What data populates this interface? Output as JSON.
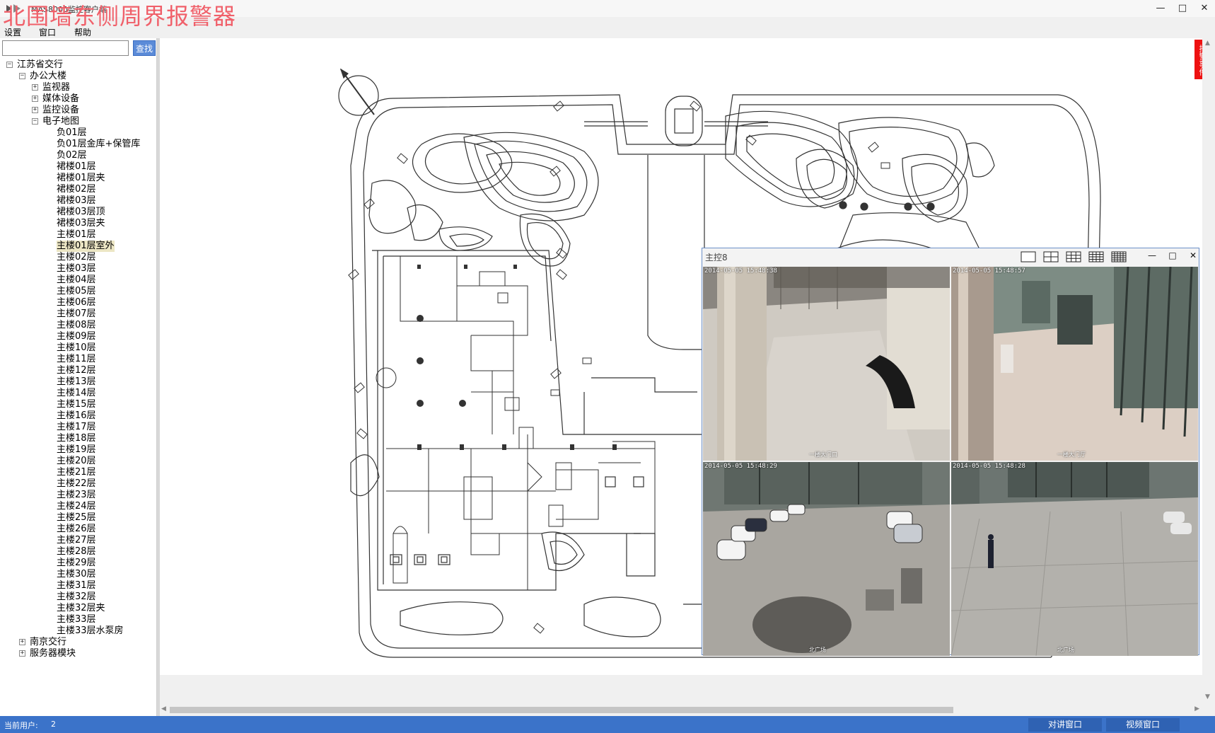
{
  "window": {
    "title": "MAS8000监控客户端",
    "alarm_overlay": "北围墙东侧周界报警器",
    "controls": [
      "minimize-icon",
      "maximize-icon",
      "close-icon"
    ]
  },
  "menu": {
    "items": [
      "设置",
      "窗口",
      "帮助"
    ]
  },
  "search": {
    "value": "",
    "button": "查找"
  },
  "tree": [
    {
      "label": "江苏省交行",
      "level": 0,
      "expander": "−"
    },
    {
      "label": "办公大楼",
      "level": 1,
      "expander": "−"
    },
    {
      "label": "监视器",
      "level": 2,
      "expander": "+"
    },
    {
      "label": "媒体设备",
      "level": 2,
      "expander": "+"
    },
    {
      "label": "监控设备",
      "level": 2,
      "expander": "+"
    },
    {
      "label": "电子地图",
      "level": 2,
      "expander": "−"
    },
    {
      "label": "负01层",
      "level": 3
    },
    {
      "label": "负01层金库+保管库",
      "level": 3
    },
    {
      "label": "负02层",
      "level": 3
    },
    {
      "label": "裙楼01层",
      "level": 3
    },
    {
      "label": "裙楼01层夹",
      "level": 3
    },
    {
      "label": "裙楼02层",
      "level": 3
    },
    {
      "label": "裙楼03层",
      "level": 3
    },
    {
      "label": "裙楼03层顶",
      "level": 3
    },
    {
      "label": "裙楼03层夹",
      "level": 3
    },
    {
      "label": "主楼01层",
      "level": 3
    },
    {
      "label": "主楼01层室外",
      "level": 3,
      "selected": true
    },
    {
      "label": "主楼02层",
      "level": 3
    },
    {
      "label": "主楼03层",
      "level": 3
    },
    {
      "label": "主楼04层",
      "level": 3
    },
    {
      "label": "主楼05层",
      "level": 3
    },
    {
      "label": "主楼06层",
      "level": 3
    },
    {
      "label": "主楼07层",
      "level": 3
    },
    {
      "label": "主楼08层",
      "level": 3
    },
    {
      "label": "主楼09层",
      "level": 3
    },
    {
      "label": "主楼10层",
      "level": 3
    },
    {
      "label": "主楼11层",
      "level": 3
    },
    {
      "label": "主楼12层",
      "level": 3
    },
    {
      "label": "主楼13层",
      "level": 3
    },
    {
      "label": "主楼14层",
      "level": 3
    },
    {
      "label": "主楼15层",
      "level": 3
    },
    {
      "label": "主楼16层",
      "level": 3
    },
    {
      "label": "主楼17层",
      "level": 3
    },
    {
      "label": "主楼18层",
      "level": 3
    },
    {
      "label": "主楼19层",
      "level": 3
    },
    {
      "label": "主楼20层",
      "level": 3
    },
    {
      "label": "主楼21层",
      "level": 3
    },
    {
      "label": "主楼22层",
      "level": 3
    },
    {
      "label": "主楼23层",
      "level": 3
    },
    {
      "label": "主楼24层",
      "level": 3
    },
    {
      "label": "主楼25层",
      "level": 3
    },
    {
      "label": "主楼26层",
      "level": 3
    },
    {
      "label": "主楼27层",
      "level": 3
    },
    {
      "label": "主楼28层",
      "level": 3
    },
    {
      "label": "主楼29层",
      "level": 3
    },
    {
      "label": "主楼30层",
      "level": 3
    },
    {
      "label": "主楼31层",
      "level": 3
    },
    {
      "label": "主楼32层",
      "level": 3
    },
    {
      "label": "主楼32层夹",
      "level": 3
    },
    {
      "label": "主楼33层",
      "level": 3
    },
    {
      "label": "主楼33层水泵房",
      "level": 3
    },
    {
      "label": "南京交行",
      "level": 1,
      "expander": "+"
    },
    {
      "label": "服务器模块",
      "level": 1,
      "expander": "+"
    }
  ],
  "alarm_tab": "报警事件",
  "video": {
    "title": "主控8",
    "layouts": [
      "layout-1x1-icon",
      "layout-2x2-icon",
      "layout-3x3-icon",
      "layout-4x4-icon",
      "layout-5x5-icon"
    ],
    "feeds": [
      {
        "timestamp": "2014-05-05 15:48:38",
        "camera": "一楼大门口",
        "scene": "lobby-reception"
      },
      {
        "timestamp": "2014-05-05 15:48:57",
        "camera": "一楼大门厅",
        "scene": "lobby-entrance"
      },
      {
        "timestamp": "2014-05-05 15:48:29",
        "camera": "北广场",
        "scene": "parking-lot"
      },
      {
        "timestamp": "2014-05-05 15:48:28",
        "camera": "北广场",
        "scene": "plaza-entrance"
      }
    ]
  },
  "status": {
    "user_label": "当前用户:",
    "user_count": "2",
    "intercom_button": "对讲窗口",
    "video_button": "视频窗口"
  },
  "colors": {
    "status_bar": "#3b73c9",
    "search_button": "#5b8bd8",
    "alarm_tab": "#ee1111",
    "alarm_overlay": "#f0606a",
    "selected_node": "#ece6c4"
  }
}
